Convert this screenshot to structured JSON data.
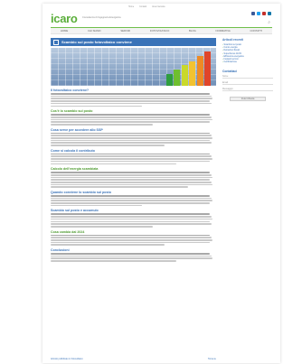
{
  "header": {
    "logo": "icaro",
    "tagline": "Consulenza di Ingegneria Energetica",
    "utility_links": [
      "Home",
      "Contatti",
      "Area riservata"
    ],
    "social_colors": [
      "#3b5998",
      "#1da1f2",
      "#c4302b",
      "#0e76a8"
    ]
  },
  "nav": {
    "items": [
      "Home",
      "Chi siamo",
      "Servizi",
      "Fotovoltaico",
      "Blog",
      "Normativa",
      "Contatti"
    ]
  },
  "article": {
    "title": "Scambio sul posto fotovoltaico conviene",
    "sections": [
      {
        "heading": "Il fotovoltaico conviene?",
        "lines": 6
      },
      {
        "heading": "Cos'è lo scambio sul posto",
        "lines": 5
      },
      {
        "heading": "Cosa serve per accedere allo SSP",
        "lines": 6
      },
      {
        "heading": "Come si calcola il contributo",
        "lines": 5
      },
      {
        "heading": "Calcolo dell'energia scambiata",
        "lines": 7
      },
      {
        "heading": "Quando conviene lo scambio sul posto",
        "lines": 5
      },
      {
        "heading": "Scambio sul posto e accumulo",
        "lines": 6
      },
      {
        "heading": "Cosa cambia dal 2024",
        "lines": 5
      },
      {
        "heading": "Conclusioni",
        "lines": 4
      }
    ],
    "footer_left": "Articolo pubblicato in Fotovoltaico",
    "footer_right": "Torna su"
  },
  "sidebar": {
    "heading": "Articoli recenti",
    "links": [
      "Scambio sul posto",
      "Conto energia",
      "Detrazioni fiscali",
      "Superbonus 110%",
      "Efficienza energetica",
      "Impianti termici",
      "Certificazione"
    ],
    "contact_heading": "Contattaci",
    "fields": [
      "Nome",
      "Email",
      "Messaggio"
    ],
    "submit_label": "Invia richiesta"
  },
  "hero": {
    "bar_colors": [
      "#2f9e3f",
      "#6fbf2f",
      "#c9d92a",
      "#f2c230",
      "#ee8a24",
      "#e0452a"
    ],
    "bar_levels": [
      0.35,
      0.48,
      0.6,
      0.72,
      0.86,
      1.0
    ]
  }
}
